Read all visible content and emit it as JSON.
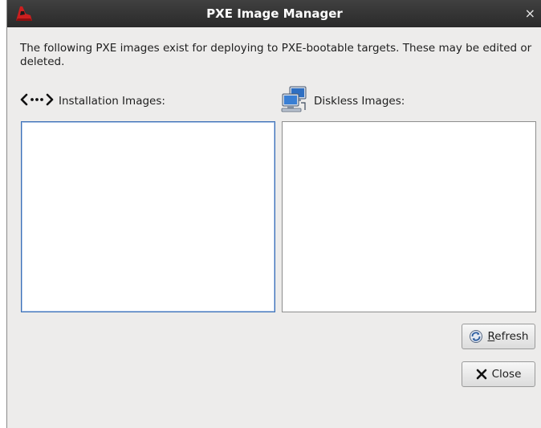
{
  "window": {
    "title": "PXE Image Manager",
    "close_glyph": "×"
  },
  "description": "The following PXE images exist for deploying to PXE-bootable targets.  These may be edited or deleted.",
  "installation": {
    "label": "Installation Images:",
    "icon": "network-arrows-icon",
    "items": []
  },
  "diskless": {
    "label": "Diskless Images:",
    "icon": "networked-computers-icon",
    "items": []
  },
  "buttons": {
    "refresh_mnemonic": "R",
    "refresh_rest": "efresh",
    "close_label": "Close"
  },
  "colors": {
    "titlebar": "#333333",
    "window_bg": "#edeceb",
    "focus_border": "#3b6fb6"
  }
}
